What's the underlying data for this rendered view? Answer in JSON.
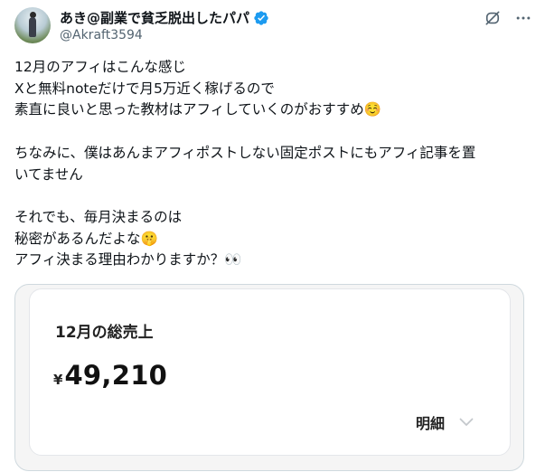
{
  "author": {
    "display_name": "あき@副業で貧乏脱出したパパ",
    "handle": "@Akraft3594",
    "avatar_icon": "profile-photo",
    "verified_icon": "verified-badge-icon",
    "verified_color": "#1d9bf0"
  },
  "header_icons": [
    "grok-slash-icon",
    "more-icon"
  ],
  "tweet": {
    "lines": [
      "12月のアフィはこんな感じ",
      "Xと無料noteだけで月5万近く稼げるので",
      "素直に良いと思った教材はアフィしていくのがおすすめ☺️",
      "",
      "ちなみに、僕はあんまアフィポストしない固定ポストにもアフィ記事を置",
      "いてません",
      "",
      "それでも、毎月決まるのは",
      "秘密があるんだよな🤫",
      "アフィ決まる理由わかりますか？👀"
    ]
  },
  "media_card": {
    "title": "12月の総売上",
    "currency": "¥",
    "amount": "49,210",
    "detail_label": "明細"
  }
}
